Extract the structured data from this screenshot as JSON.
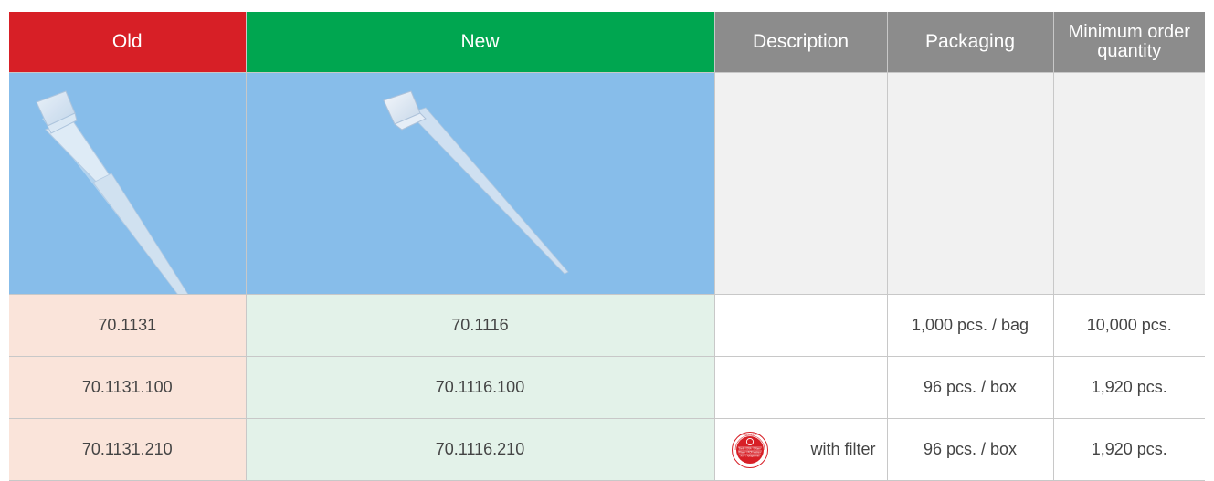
{
  "headers": {
    "old": "Old",
    "new": "New",
    "description": "Description",
    "packaging": "Packaging",
    "moq": "Minimum order quantity"
  },
  "colors": {
    "old_header": "#d71f26",
    "new_header": "#00a650",
    "gray_header": "#8c8c8c",
    "image_bg": "#87bdea",
    "old_cell": "#fae4da",
    "new_cell": "#e3f2e9"
  },
  "images": {
    "old": "pipette-tip-old-icon",
    "new": "pipette-tip-new-icon"
  },
  "rows": [
    {
      "old": "70.1131",
      "new": "70.1116",
      "description": "",
      "packaging": "1,000 pcs. / bag",
      "moq": "10,000 pcs."
    },
    {
      "old": "70.1131.100",
      "new": "70.1116.100",
      "description": "",
      "packaging": "96 pcs. / box",
      "moq": "1,920 pcs."
    },
    {
      "old": "70.1131.210",
      "new": "70.1116.210",
      "description": "with filter",
      "packaging": "96 pcs. / box",
      "moq": "1,920 pcs.",
      "badge": "biosphere-plus-certified-seal"
    }
  ],
  "seal_text": {
    "top": "Biosphere® plus",
    "lines": [
      "Sterile / DNA- / DNase-",
      "RNase- / PCR inhibitor-",
      "ATP- / Pyrogen-free"
    ],
    "bottom": "CERTIFIED"
  }
}
